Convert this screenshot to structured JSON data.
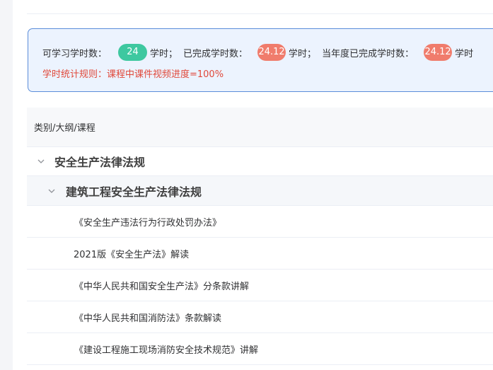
{
  "summary": {
    "available_label": "可学习学时数：",
    "available_value": "24",
    "unit1": "学时；",
    "completed_label": "已完成学时数：",
    "completed_value": "24.12",
    "unit2": "学时；",
    "year_completed_label": "当年度已完成学时数：",
    "year_completed_value": "24.12",
    "unit3": "学时",
    "rule_text": "学时统计规则：课程中课件视频进度=100%"
  },
  "table": {
    "header": "类别/大纲/课程",
    "category": "安全生产法律法规",
    "outline": "建筑工程安全生产法律法规",
    "courses": [
      "《安全生产违法行为行政处罚办法》",
      "2021版《安全生产法》解读",
      "《中华人民共和国安全生产法》分条款讲解",
      "《中华人民共和国消防法》条款解读",
      "《建设工程施工现场消防安全技术规范》讲解"
    ]
  },
  "colors": {
    "accent_green": "#3ec8a0",
    "accent_red": "#f07c6c",
    "rule_red": "#e0483a",
    "box_border": "#5b8dd9",
    "box_bg": "#ecf3fe"
  },
  "icons": {
    "expand": "chevron-down-icon"
  }
}
